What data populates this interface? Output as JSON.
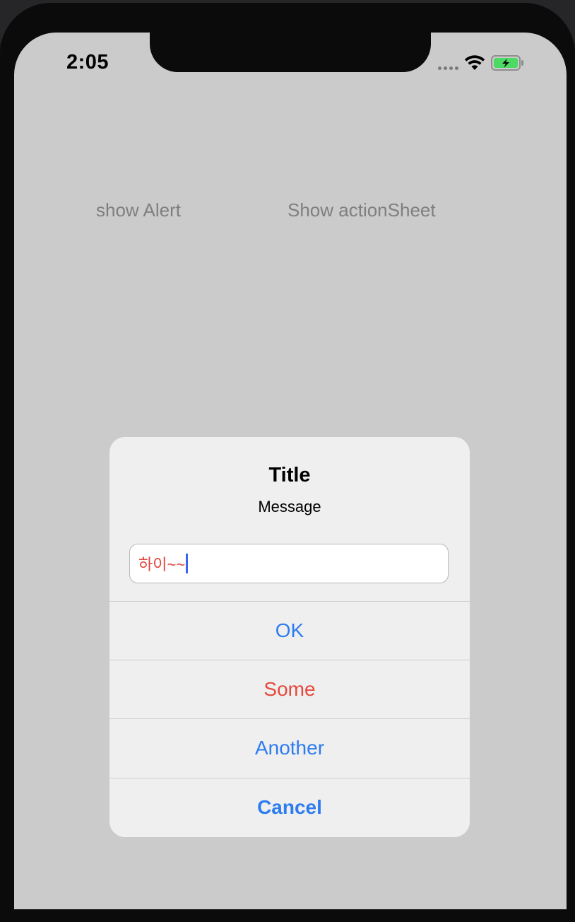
{
  "status_bar": {
    "time": "2:05",
    "wifi_icon": "wifi-icon",
    "battery_icon": "battery-charging-icon",
    "battery_color": "#4cd964"
  },
  "main": {
    "show_alert_label": "show Alert",
    "show_action_sheet_label": "Show actionSheet"
  },
  "alert": {
    "title": "Title",
    "message": "Message",
    "input_value": "하이~~",
    "actions": [
      {
        "label": "OK",
        "color": "#2d7cf0"
      },
      {
        "label": "Some",
        "color": "#e44a3d"
      },
      {
        "label": "Another",
        "color": "#2d7cf0"
      },
      {
        "label": "Cancel",
        "color": "#2d7cf0"
      }
    ]
  }
}
